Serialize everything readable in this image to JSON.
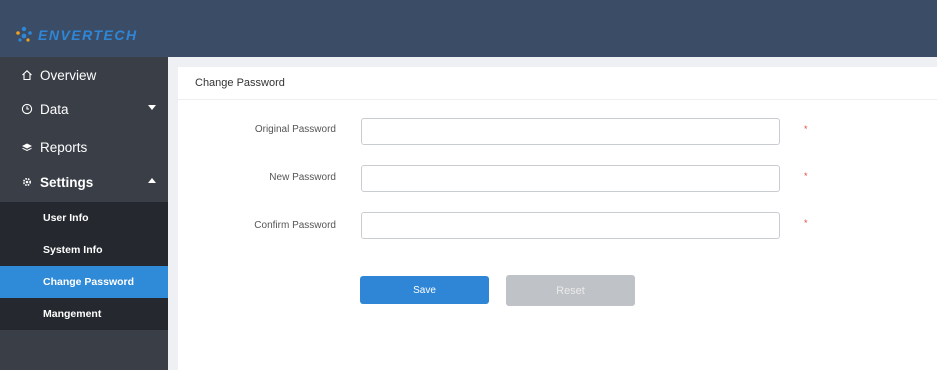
{
  "brand": {
    "name": "ENVERTECH"
  },
  "sidebar": {
    "items": [
      {
        "label": "Overview",
        "icon": "home-icon"
      },
      {
        "label": "Data",
        "icon": "clock-icon"
      },
      {
        "label": "Reports",
        "icon": "layers-icon"
      },
      {
        "label": "Settings",
        "icon": "gear-icon"
      }
    ],
    "sub_items": [
      {
        "label": "User Info"
      },
      {
        "label": "System Info"
      },
      {
        "label": "Change Password",
        "active": true
      },
      {
        "label": "Mangement"
      }
    ]
  },
  "panel": {
    "title": "Change Password",
    "fields": [
      {
        "label": "Original Password",
        "value": "",
        "required": "*"
      },
      {
        "label": "New Password",
        "value": "",
        "required": "*"
      },
      {
        "label": "Confirm Password",
        "value": "",
        "required": "*"
      }
    ],
    "save_label": "Save",
    "reset_label": "Reset"
  },
  "colors": {
    "topbar": "#3b4d66",
    "sidebar": "#3a3f47",
    "submenu": "#25292f",
    "accent": "#2f86d6",
    "required": "#e04a3f"
  }
}
